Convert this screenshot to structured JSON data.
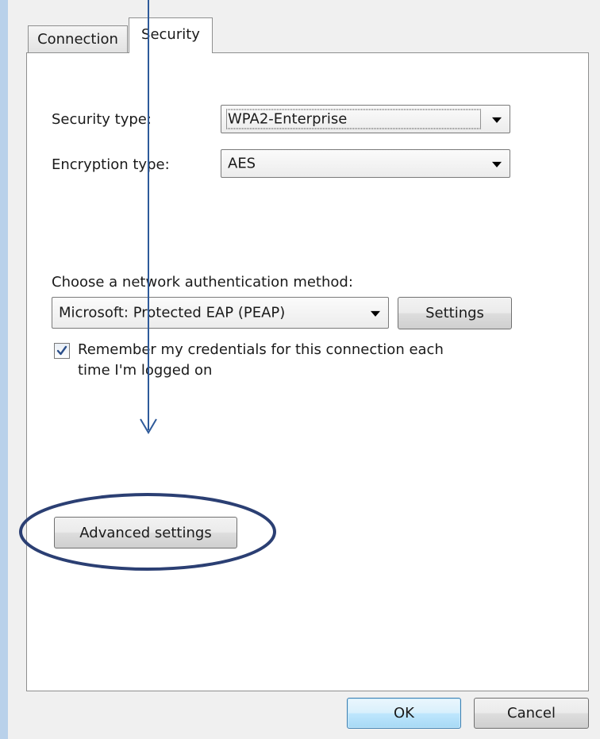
{
  "tabs": [
    {
      "label": "Connection",
      "active": false
    },
    {
      "label": "Security",
      "active": true
    }
  ],
  "security_type": {
    "label": "Security type:",
    "value": "WPA2-Enterprise"
  },
  "encryption_type": {
    "label": "Encryption type:",
    "value": "AES"
  },
  "auth_method": {
    "label": "Choose a network authentication method:",
    "value": "Microsoft: Protected EAP (PEAP)",
    "settings_label": "Settings"
  },
  "remember_credentials": {
    "checked": true,
    "line1": "Remember my credentials for this connection each",
    "line2": "time I'm logged on"
  },
  "advanced_settings_label": "Advanced settings",
  "footer": {
    "ok_label": "OK",
    "cancel_label": "Cancel"
  },
  "annotation_color": "#2e4a8a"
}
